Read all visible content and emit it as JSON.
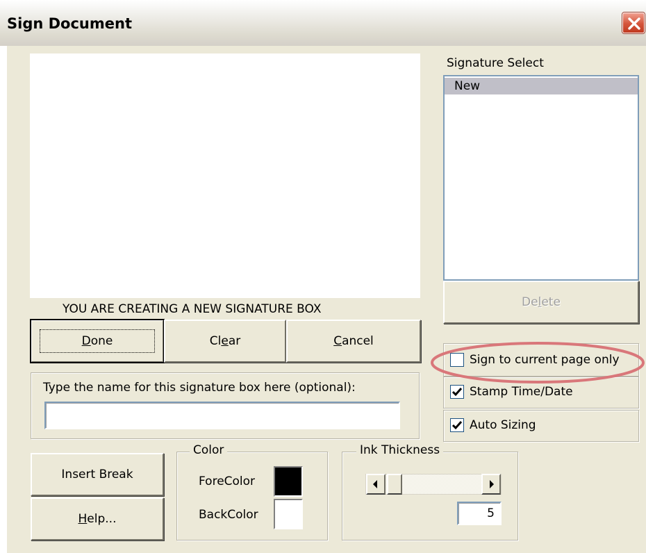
{
  "window": {
    "title": "Sign Document"
  },
  "signature_select": {
    "label": "Signature Select",
    "items": [
      {
        "label": "New",
        "selected": true
      }
    ],
    "delete_label_pre": "De",
    "delete_label_accel": "l",
    "delete_label_post": "ete"
  },
  "status_message": "YOU ARE CREATING A NEW SIGNATURE BOX",
  "buttons": {
    "done_accel": "D",
    "done_rest": "one",
    "clear_pre": "Cl",
    "clear_accel": "e",
    "clear_post": "ar",
    "cancel_accel": "C",
    "cancel_rest": "ancel",
    "insert_break": "Insert Break",
    "help_accel": "H",
    "help_rest": "elp..."
  },
  "name_box": {
    "label": "Type the name for this signature box here (optional):",
    "value": ""
  },
  "options": {
    "sign_current_page": {
      "label": "Sign to current page only",
      "checked": false
    },
    "stamp_time_date": {
      "label": "Stamp Time/Date",
      "checked": true
    },
    "auto_sizing": {
      "label": "Auto Sizing",
      "checked": true
    }
  },
  "color_group": {
    "label": "Color",
    "fore_label": "ForeColor",
    "fore_color": "#000000",
    "back_label": "BackColor",
    "back_color": "#ffffff"
  },
  "ink_thickness": {
    "label": "Ink Thickness",
    "value": "5"
  },
  "highlight": {
    "color": "#d9777a"
  }
}
